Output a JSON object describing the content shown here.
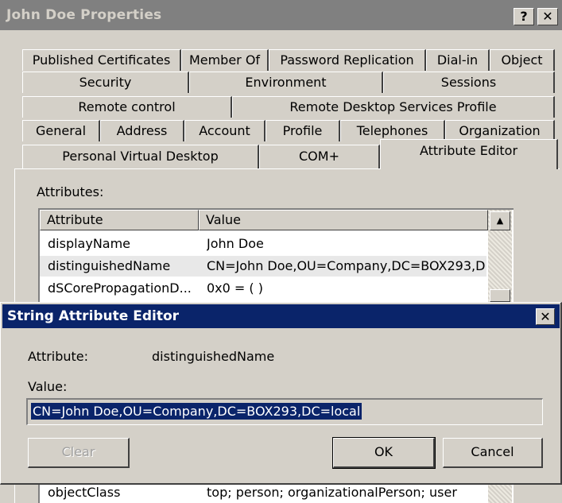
{
  "window": {
    "title": "John Doe Properties",
    "help_label": "?",
    "close_label": "✕"
  },
  "tabs": {
    "row1": [
      "Published Certificates",
      "Member Of",
      "Password Replication",
      "Dial-in",
      "Object"
    ],
    "row2": [
      "Security",
      "Environment",
      "Sessions"
    ],
    "row3": [
      "Remote control",
      "Remote Desktop Services Profile"
    ],
    "row4": [
      "General",
      "Address",
      "Account",
      "Profile",
      "Telephones",
      "Organization"
    ],
    "row5": [
      "Personal Virtual Desktop",
      "COM+",
      "Attribute Editor"
    ],
    "active": "Attribute Editor"
  },
  "attributes": {
    "label": "Attributes:",
    "columns": [
      "Attribute",
      "Value"
    ],
    "rows": [
      {
        "name": "displayName",
        "value": "John Doe"
      },
      {
        "name": "distinguishedName",
        "value": "CN=John Doe,OU=Company,DC=BOX293,D"
      },
      {
        "name": "dSCorePropagationD...",
        "value": "0x0 = ( )"
      },
      {
        "name": "objectClass",
        "value": "top; person; organizationalPerson; user"
      }
    ],
    "scroll_up_glyph": "▲"
  },
  "dialog": {
    "title": "String Attribute Editor",
    "close_label": "✕",
    "attribute_label": "Attribute:",
    "attribute_value": "distinguishedName",
    "value_label": "Value:",
    "value": "CN=John Doe,OU=Company,DC=BOX293,DC=local",
    "clear_label": "Clear",
    "ok_label": "OK",
    "cancel_label": "Cancel"
  }
}
